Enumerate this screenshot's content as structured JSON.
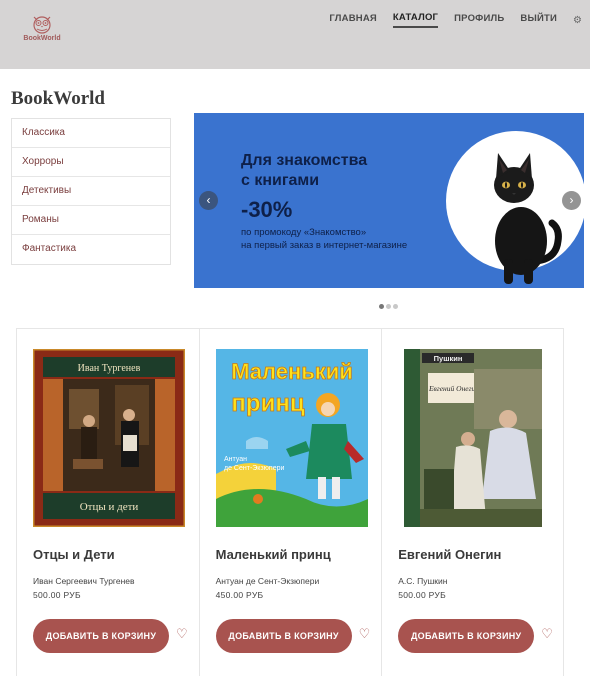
{
  "header": {
    "logo_text": "BookWorld",
    "nav": [
      "ГЛАВНАЯ",
      "КАТАЛОГ",
      "ПРОФИЛЬ",
      "ВЫЙТИ"
    ],
    "active_nav": "КАТАЛОГ",
    "settings_icon": "gear-icon",
    "colors": {
      "background": "#d6d4d4",
      "logo": "#a05a5a"
    }
  },
  "brand_title": "BookWorld",
  "sidebar": {
    "items": [
      "Классика",
      "Хорроры",
      "Детективы",
      "Романы",
      "Фантастика"
    ]
  },
  "banner": {
    "heading_line1": "Для знакомства",
    "heading_line2": "с книгами",
    "discount": "-30%",
    "sub_line1": "по промокоду «Знакомство»",
    "sub_line2": "на первый заказ в интернет-магазине",
    "prev_icon": "chevron-left-icon",
    "next_icon": "chevron-right-icon",
    "slides_total": 3,
    "active_slide": 1,
    "colors": {
      "background": "#3a73cf",
      "text": "#0e2049"
    }
  },
  "products": [
    {
      "cover_author": "Иван Тургенев",
      "cover_title": "Отцы и дети",
      "title": "Отцы и Дети",
      "author": "Иван Сергеевич Тургенев",
      "price": "500.00 РУБ",
      "button_label": "ДОБАВИТЬ В КОРЗИНУ"
    },
    {
      "cover_title_line1": "Маленький",
      "cover_title_line2": "принц",
      "cover_author_line1": "Антуан",
      "cover_author_line2": "де Сент-Экзюпери",
      "title": "Маленький принц",
      "author": "Антуан де Сент-Экзюпери",
      "price": "450.00 РУБ",
      "button_label": "ДОБАВИТЬ В КОРЗИНУ"
    },
    {
      "cover_author": "Пушкин",
      "cover_title": "Евгений Онегин",
      "title": "Евгений Онегин",
      "author": "А.С. Пушкин",
      "price": "500.00 РУБ",
      "button_label": "ДОБАВИТЬ В КОРЗИНУ"
    }
  ],
  "colors": {
    "accent": "#a8534f",
    "sidebar_text": "#7a3e3e"
  }
}
